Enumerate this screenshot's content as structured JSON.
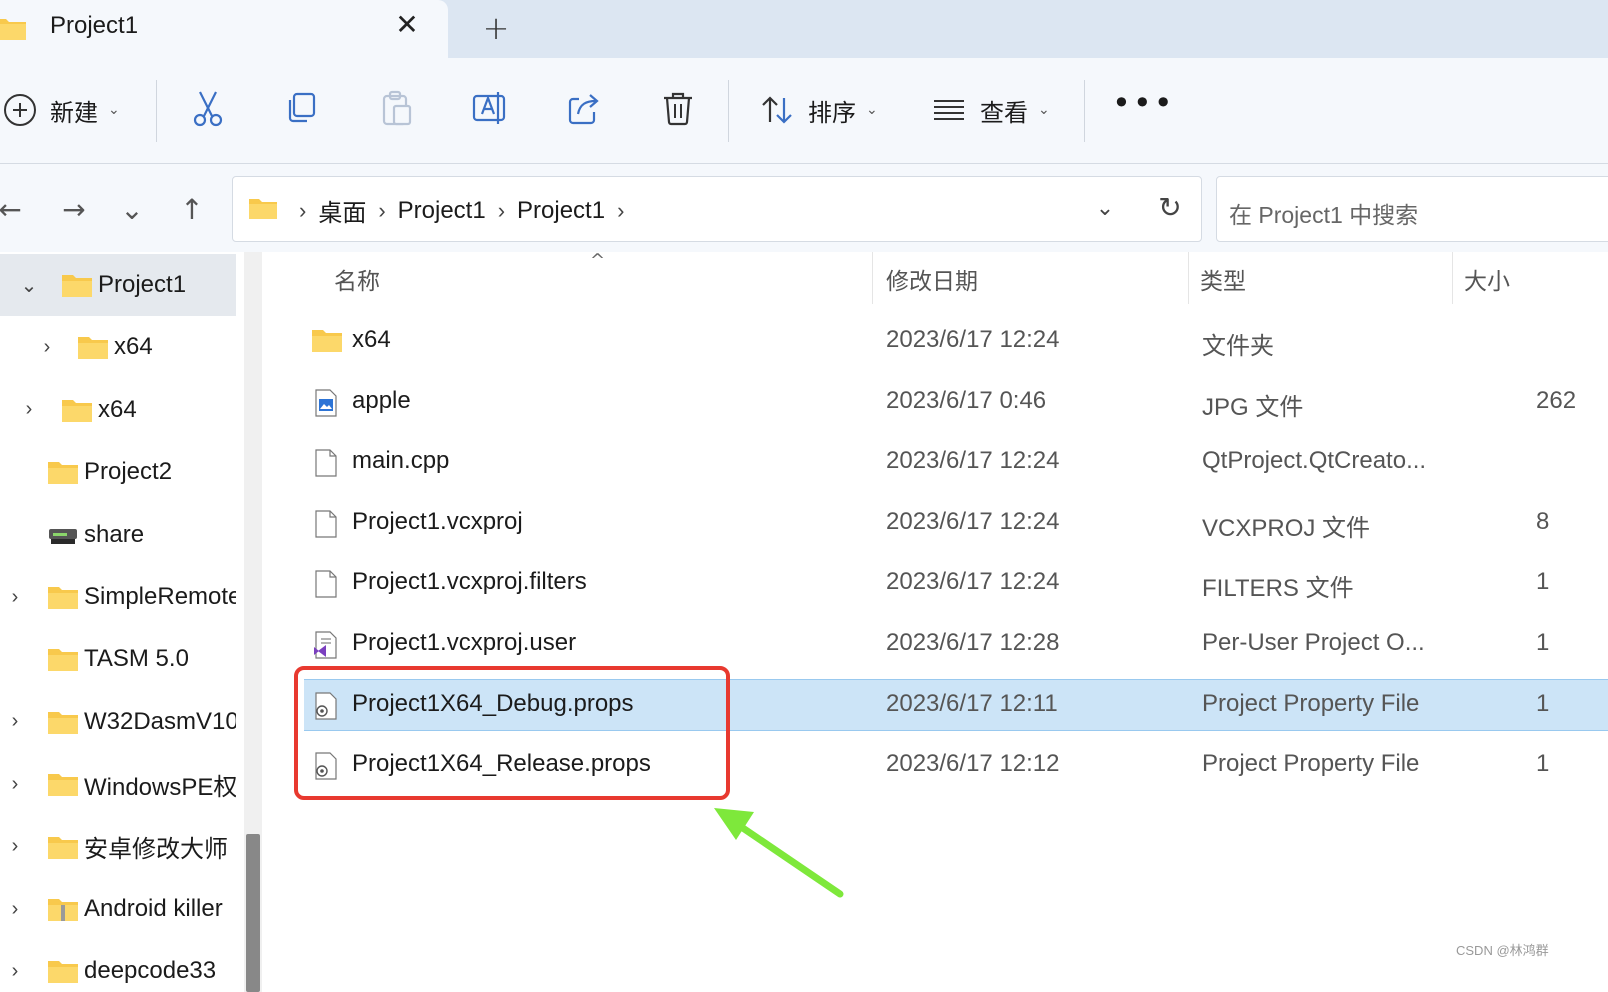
{
  "tab": {
    "title": "Project1",
    "close": "✕",
    "new": "+"
  },
  "toolbar": {
    "new_label": "新建",
    "sort_label": "排序",
    "view_label": "查看",
    "more": "•••",
    "dropdown_chevron": "⌄",
    "icons": [
      "cut-icon",
      "copy-icon",
      "paste-icon",
      "rename-icon",
      "share-icon",
      "delete-icon"
    ]
  },
  "nav": {
    "back": "←",
    "forward": "→",
    "recent": "⌄",
    "up": "↑"
  },
  "address": {
    "crumbs": [
      "桌面",
      "Project1",
      "Project1"
    ],
    "separator": "›",
    "dropdown": "⌄",
    "refresh": "↻"
  },
  "search": {
    "placeholder": "在 Project1 中搜索"
  },
  "sidebar": {
    "items": [
      {
        "label": "Project1",
        "arrow": "⌄",
        "expanded": true,
        "selected": true,
        "icon": "folder-icon"
      },
      {
        "label": "x64",
        "arrow": "›",
        "icon": "folder-icon"
      },
      {
        "label": "x64",
        "arrow": "›",
        "icon": "folder-icon"
      },
      {
        "label": "Project2",
        "arrow": "",
        "icon": "folder-icon"
      },
      {
        "label": "share",
        "arrow": "",
        "icon": "network-drive-icon"
      },
      {
        "label": "SimpleRemote",
        "arrow": "›",
        "icon": "folder-icon"
      },
      {
        "label": "TASM 5.0",
        "arrow": "",
        "icon": "folder-icon"
      },
      {
        "label": "W32DasmV10",
        "arrow": "›",
        "icon": "folder-icon"
      },
      {
        "label": "WindowsPE权",
        "arrow": "›",
        "icon": "folder-icon"
      },
      {
        "label": "安卓修改大师",
        "arrow": "›",
        "icon": "folder-icon"
      },
      {
        "label": "Android killer",
        "arrow": "›",
        "icon": "zip-folder-icon"
      },
      {
        "label": "deepcode33",
        "arrow": "›",
        "icon": "folder-icon"
      }
    ]
  },
  "columns": {
    "name": "名称",
    "date": "修改日期",
    "type": "类型",
    "size": "大小",
    "sort_indicator": "^"
  },
  "files": [
    {
      "name": "x64",
      "date": "2023/6/17 12:24",
      "type": "文件夹",
      "size": "",
      "icon": "folder-icon"
    },
    {
      "name": "apple",
      "date": "2023/6/17 0:46",
      "type": "JPG 文件",
      "size": "262",
      "icon": "image-file-icon"
    },
    {
      "name": "main.cpp",
      "date": "2023/6/17 12:24",
      "type": "QtProject.QtCreato...",
      "size": "",
      "icon": "file-icon"
    },
    {
      "name": "Project1.vcxproj",
      "date": "2023/6/17 12:24",
      "type": "VCXPROJ 文件",
      "size": "8",
      "icon": "file-icon"
    },
    {
      "name": "Project1.vcxproj.filters",
      "date": "2023/6/17 12:24",
      "type": "FILTERS 文件",
      "size": "1",
      "icon": "file-icon"
    },
    {
      "name": "Project1.vcxproj.user",
      "date": "2023/6/17 12:28",
      "type": "Per-User Project O...",
      "size": "1",
      "icon": "visual-studio-file-icon"
    },
    {
      "name": "Project1X64_Debug.props",
      "date": "2023/6/17 12:11",
      "type": "Project Property File",
      "size": "1",
      "icon": "props-file-icon",
      "selected": true
    },
    {
      "name": "Project1X64_Release.props",
      "date": "2023/6/17 12:12",
      "type": "Project Property File",
      "size": "1",
      "icon": "props-file-icon"
    }
  ],
  "annotation": {
    "box_color": "#e8392f",
    "arrow_color": "#7ee83b"
  },
  "watermark": "CSDN @林鸿群",
  "colors": {
    "selection": "#cce4f7",
    "folder": "#f8c94c",
    "accent": "#0067c0"
  }
}
